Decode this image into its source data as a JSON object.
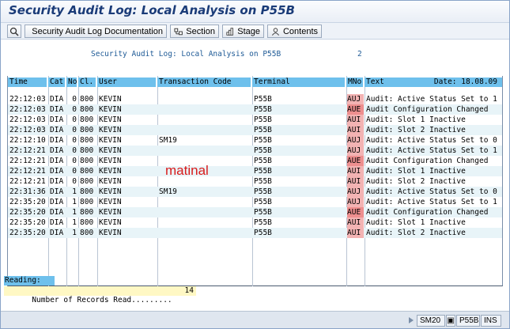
{
  "window": {
    "title": "Security Audit Log: Local Analysis on P55B"
  },
  "toolbar": {
    "buttons": [
      {
        "label": "",
        "icon": "save-layout-icon"
      },
      {
        "label": "Security Audit Log Documentation",
        "icon": "document-icon"
      },
      {
        "label": "Section",
        "icon": "section-icon"
      },
      {
        "label": "Stage",
        "icon": "stage-icon"
      },
      {
        "label": "Contents",
        "icon": "contents-icon"
      }
    ]
  },
  "report": {
    "heading": "Security Audit Log: Local Analysis on P55B",
    "page": "2",
    "columns": [
      "Time",
      "Cat",
      "No",
      "Cl.",
      "User",
      "Transaction Code",
      "Terminal",
      "MNo",
      "Text",
      "Date: 18.08.09"
    ],
    "rows": [
      {
        "time": "22:12:03",
        "cat": "DIA",
        "no": "0",
        "cl": "800",
        "user": "KEVIN",
        "tcode": "",
        "terminal": "P55B",
        "mno": "AUJ",
        "text": "Audit: Active Status Set to 1"
      },
      {
        "time": "22:12:03",
        "cat": "DIA",
        "no": "0",
        "cl": "800",
        "user": "KEVIN",
        "tcode": "",
        "terminal": "P55B",
        "mno": "AUE",
        "text": "Audit Configuration Changed"
      },
      {
        "time": "22:12:03",
        "cat": "DIA",
        "no": "0",
        "cl": "800",
        "user": "KEVIN",
        "tcode": "",
        "terminal": "P55B",
        "mno": "AUI",
        "text": "Audit: Slot 1 Inactive"
      },
      {
        "time": "22:12:03",
        "cat": "DIA",
        "no": "0",
        "cl": "800",
        "user": "KEVIN",
        "tcode": "",
        "terminal": "P55B",
        "mno": "AUI",
        "text": "Audit: Slot 2 Inactive"
      },
      {
        "time": "22:12:10",
        "cat": "DIA",
        "no": "0",
        "cl": "800",
        "user": "KEVIN",
        "tcode": "SM19",
        "terminal": "P55B",
        "mno": "AUJ",
        "text": "Audit: Active Status Set to 0"
      },
      {
        "time": "22:12:21",
        "cat": "DIA",
        "no": "0",
        "cl": "800",
        "user": "KEVIN",
        "tcode": "",
        "terminal": "P55B",
        "mno": "AUJ",
        "text": "Audit: Active Status Set to 1"
      },
      {
        "time": "22:12:21",
        "cat": "DIA",
        "no": "0",
        "cl": "800",
        "user": "KEVIN",
        "tcode": "",
        "terminal": "P55B",
        "mno": "AUE",
        "text": "Audit Configuration Changed"
      },
      {
        "time": "22:12:21",
        "cat": "DIA",
        "no": "0",
        "cl": "800",
        "user": "KEVIN",
        "tcode": "",
        "terminal": "P55B",
        "mno": "AUI",
        "text": "Audit: Slot 1 Inactive"
      },
      {
        "time": "22:12:21",
        "cat": "DIA",
        "no": "0",
        "cl": "800",
        "user": "KEVIN",
        "tcode": "",
        "terminal": "P55B",
        "mno": "AUI",
        "text": "Audit: Slot 2 Inactive"
      },
      {
        "time": "22:31:36",
        "cat": "DIA",
        "no": "1",
        "cl": "800",
        "user": "KEVIN",
        "tcode": "SM19",
        "terminal": "P55B",
        "mno": "AUJ",
        "text": "Audit: Active Status Set to 0"
      },
      {
        "time": "22:35:20",
        "cat": "DIA",
        "no": "1",
        "cl": "800",
        "user": "KEVIN",
        "tcode": "",
        "terminal": "P55B",
        "mno": "AUJ",
        "text": "Audit: Active Status Set to 1"
      },
      {
        "time": "22:35:20",
        "cat": "DIA",
        "no": "1",
        "cl": "800",
        "user": "KEVIN",
        "tcode": "",
        "terminal": "P55B",
        "mno": "AUE",
        "text": "Audit Configuration Changed"
      },
      {
        "time": "22:35:20",
        "cat": "DIA",
        "no": "1",
        "cl": "800",
        "user": "KEVIN",
        "tcode": "",
        "terminal": "P55B",
        "mno": "AUI",
        "text": "Audit: Slot 1 Inactive"
      },
      {
        "time": "22:35:20",
        "cat": "DIA",
        "no": "1",
        "cl": "800",
        "user": "KEVIN",
        "tcode": "",
        "terminal": "P55B",
        "mno": "AUI",
        "text": "Audit: Slot 2 Inactive"
      }
    ],
    "watermark": "matinal",
    "reading_label": "Reading:",
    "records_label": "Number of Records Read.........",
    "records_count": "14"
  },
  "statusbar": {
    "transaction": "SM20",
    "system": "P55B",
    "mode": "INS"
  },
  "colors": {
    "header_blue": "#6ec0ec",
    "title_blue": "#1a3b78",
    "mno_red": "#f3b3b3",
    "watermark_red": "#d81b1b"
  }
}
